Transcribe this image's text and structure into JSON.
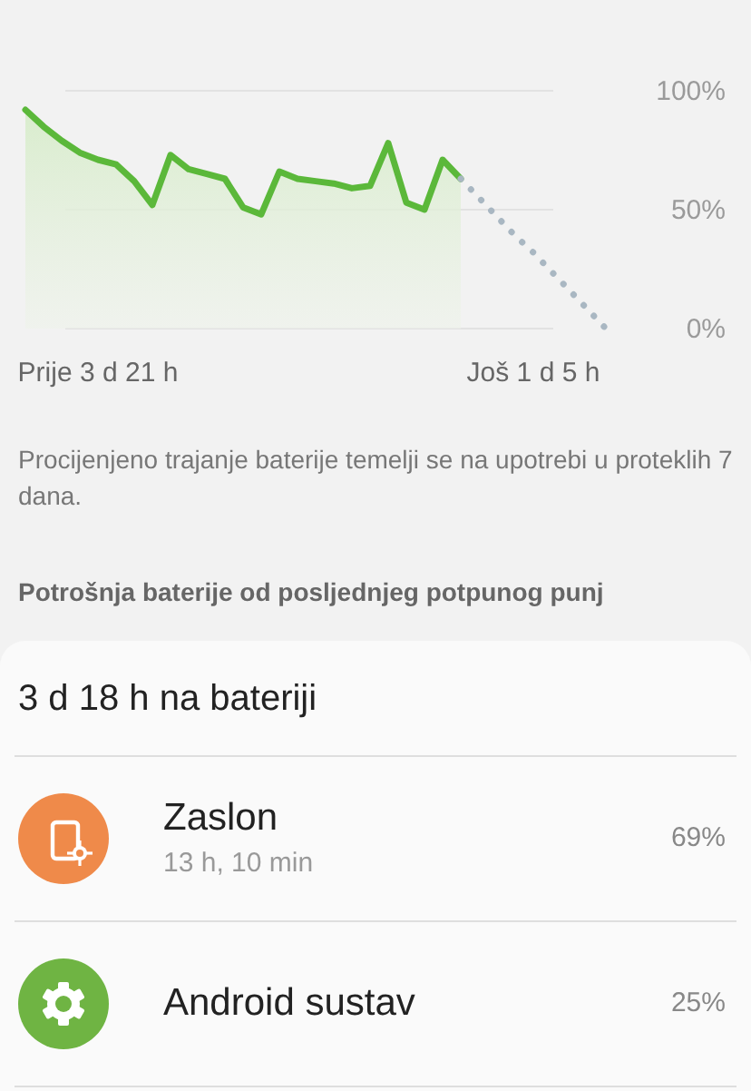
{
  "battery_chart": {
    "chart_data": {
      "type": "area",
      "categories": [
        null,
        null,
        null,
        null,
        "Prije 3 d 21 h",
        null,
        null,
        null,
        null,
        null,
        null,
        null,
        null,
        null,
        null,
        null,
        null,
        null,
        null,
        null,
        null,
        null,
        null,
        null,
        null,
        null,
        null,
        null,
        "Još 1 d 5 h",
        null,
        null,
        null,
        null
      ],
      "ylim": [
        0,
        100
      ],
      "yticks": [
        {
          "value": 0,
          "label": "0%"
        },
        {
          "value": 50,
          "label": "50%"
        },
        {
          "value": 100,
          "label": "100%"
        }
      ],
      "series": [
        {
          "color": "#5bb83a",
          "values": [
            92,
            85,
            79,
            74,
            71,
            69,
            62,
            52,
            73,
            67,
            65,
            63,
            51,
            48,
            66,
            63,
            62,
            61,
            59,
            60,
            78,
            53,
            50,
            71,
            63,
            null,
            null,
            null,
            null,
            null,
            null,
            null,
            null
          ]
        },
        {
          "type": "line",
          "color": "#a9b7c2",
          "line_style": "dotted",
          "values": [
            null,
            null,
            null,
            null,
            null,
            null,
            null,
            null,
            null,
            null,
            null,
            null,
            null,
            null,
            null,
            null,
            null,
            null,
            null,
            null,
            null,
            null,
            null,
            null,
            63,
            55,
            47,
            39,
            32,
            24,
            16,
            8,
            0
          ]
        }
      ]
    }
  },
  "note": "Procijenjeno trajanje baterije temelji se na upotrebi u proteklih 7 dana.",
  "section_title": "Potrošnja baterije od posljednjeg potpunog punj",
  "usage_card": {
    "title": "3 d 18 h na bateriji",
    "items": [
      {
        "kind": "screen",
        "name": "Zaslon",
        "detail": "13 h, 10 min",
        "percent": "69%",
        "color": "#ef8a4a"
      },
      {
        "kind": "system",
        "name": "Android sustav",
        "percent": "25%",
        "color": "#6fb443"
      }
    ]
  }
}
